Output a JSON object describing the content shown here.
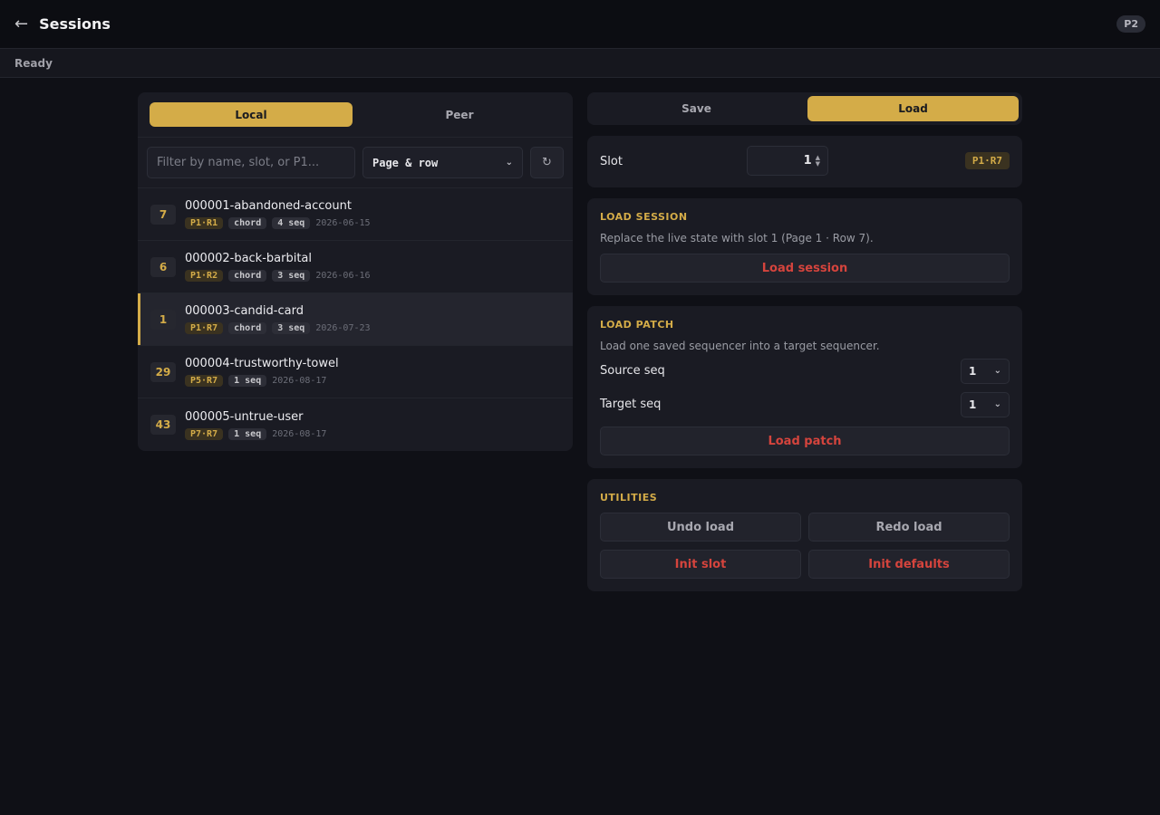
{
  "header": {
    "back_icon": "←",
    "title": "Sessions",
    "badge": "P2"
  },
  "status": "Ready",
  "sources": {
    "local": "Local",
    "peer": "Peer"
  },
  "filter": {
    "placeholder": "Filter by name, slot, or P1...",
    "sort": "Page & row",
    "refresh_icon": "↻"
  },
  "sessions": [
    {
      "slot": "7",
      "name": "000001-abandoned-account",
      "pos": "P1·R1",
      "tags": [
        "chord",
        "4 seq"
      ],
      "date": "2026-06-15"
    },
    {
      "slot": "6",
      "name": "000002-back-barbital",
      "pos": "P1·R2",
      "tags": [
        "chord",
        "3 seq"
      ],
      "date": "2026-06-16"
    },
    {
      "slot": "1",
      "name": "000003-candid-card",
      "pos": "P1·R7",
      "tags": [
        "chord",
        "3 seq"
      ],
      "date": "2026-07-23"
    },
    {
      "slot": "29",
      "name": "000004-trustworthy-towel",
      "pos": "P5·R7",
      "tags": [
        "1 seq"
      ],
      "date": "2026-08-17"
    },
    {
      "slot": "43",
      "name": "000005-untrue-user",
      "pos": "P7·R7",
      "tags": [
        "1 seq"
      ],
      "date": "2026-08-17"
    }
  ],
  "tabs": {
    "save": "Save",
    "load": "Load"
  },
  "slot": {
    "label": "Slot",
    "value": "1",
    "pos": "P1·R7"
  },
  "load_session": {
    "title": "LOAD SESSION",
    "desc": "Replace the live state with slot 1 (Page 1 · Row 7).",
    "button": "Load session"
  },
  "load_patch": {
    "title": "LOAD PATCH",
    "desc": "Load one saved sequencer into a target sequencer.",
    "source_label": "Source seq",
    "source_value": "1",
    "target_label": "Target seq",
    "target_value": "1",
    "button": "Load patch"
  },
  "utilities": {
    "title": "UTILITIES",
    "undo": "Undo load",
    "redo": "Redo load",
    "init_slot": "Init slot",
    "init_defaults": "Init defaults"
  }
}
